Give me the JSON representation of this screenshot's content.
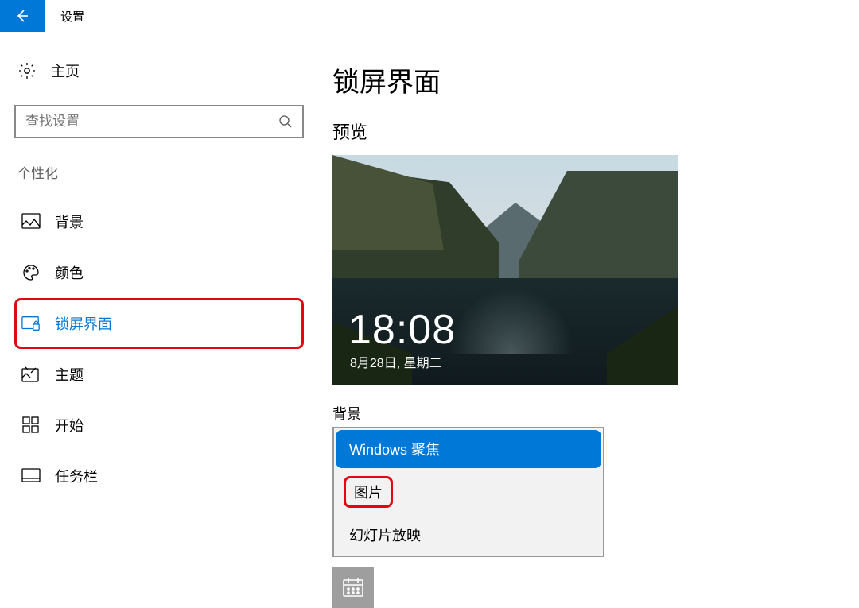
{
  "titlebar": {
    "title": "设置"
  },
  "sidebar": {
    "home_label": "主页",
    "search_placeholder": "查找设置",
    "section_label": "个性化",
    "items": [
      {
        "label": "背景"
      },
      {
        "label": "颜色"
      },
      {
        "label": "锁屏界面"
      },
      {
        "label": "主题"
      },
      {
        "label": "开始"
      },
      {
        "label": "任务栏"
      }
    ]
  },
  "content": {
    "page_title": "锁屏界面",
    "preview_label": "预览",
    "lockscreen": {
      "time": "18:08",
      "date": "8月28日, 星期二"
    },
    "background_label": "背景",
    "background_options": [
      {
        "label": "Windows 聚焦",
        "selected": true
      },
      {
        "label": "图片",
        "highlighted": true
      },
      {
        "label": "幻灯片放映"
      }
    ]
  }
}
